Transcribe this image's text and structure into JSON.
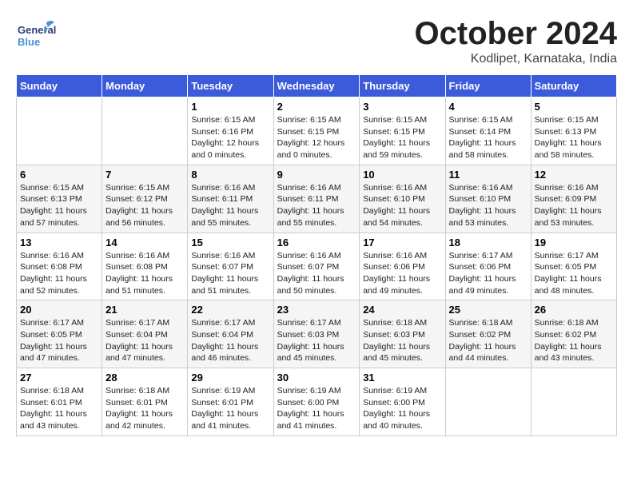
{
  "header": {
    "logo_general": "General",
    "logo_blue": "Blue",
    "month": "October 2024",
    "location": "Kodlipet, Karnataka, India"
  },
  "weekdays": [
    "Sunday",
    "Monday",
    "Tuesday",
    "Wednesday",
    "Thursday",
    "Friday",
    "Saturday"
  ],
  "weeks": [
    [
      {
        "day": "",
        "info": ""
      },
      {
        "day": "",
        "info": ""
      },
      {
        "day": "1",
        "info": "Sunrise: 6:15 AM\nSunset: 6:16 PM\nDaylight: 12 hours\nand 0 minutes."
      },
      {
        "day": "2",
        "info": "Sunrise: 6:15 AM\nSunset: 6:15 PM\nDaylight: 12 hours\nand 0 minutes."
      },
      {
        "day": "3",
        "info": "Sunrise: 6:15 AM\nSunset: 6:15 PM\nDaylight: 11 hours\nand 59 minutes."
      },
      {
        "day": "4",
        "info": "Sunrise: 6:15 AM\nSunset: 6:14 PM\nDaylight: 11 hours\nand 58 minutes."
      },
      {
        "day": "5",
        "info": "Sunrise: 6:15 AM\nSunset: 6:13 PM\nDaylight: 11 hours\nand 58 minutes."
      }
    ],
    [
      {
        "day": "6",
        "info": "Sunrise: 6:15 AM\nSunset: 6:13 PM\nDaylight: 11 hours\nand 57 minutes."
      },
      {
        "day": "7",
        "info": "Sunrise: 6:15 AM\nSunset: 6:12 PM\nDaylight: 11 hours\nand 56 minutes."
      },
      {
        "day": "8",
        "info": "Sunrise: 6:16 AM\nSunset: 6:11 PM\nDaylight: 11 hours\nand 55 minutes."
      },
      {
        "day": "9",
        "info": "Sunrise: 6:16 AM\nSunset: 6:11 PM\nDaylight: 11 hours\nand 55 minutes."
      },
      {
        "day": "10",
        "info": "Sunrise: 6:16 AM\nSunset: 6:10 PM\nDaylight: 11 hours\nand 54 minutes."
      },
      {
        "day": "11",
        "info": "Sunrise: 6:16 AM\nSunset: 6:10 PM\nDaylight: 11 hours\nand 53 minutes."
      },
      {
        "day": "12",
        "info": "Sunrise: 6:16 AM\nSunset: 6:09 PM\nDaylight: 11 hours\nand 53 minutes."
      }
    ],
    [
      {
        "day": "13",
        "info": "Sunrise: 6:16 AM\nSunset: 6:08 PM\nDaylight: 11 hours\nand 52 minutes."
      },
      {
        "day": "14",
        "info": "Sunrise: 6:16 AM\nSunset: 6:08 PM\nDaylight: 11 hours\nand 51 minutes."
      },
      {
        "day": "15",
        "info": "Sunrise: 6:16 AM\nSunset: 6:07 PM\nDaylight: 11 hours\nand 51 minutes."
      },
      {
        "day": "16",
        "info": "Sunrise: 6:16 AM\nSunset: 6:07 PM\nDaylight: 11 hours\nand 50 minutes."
      },
      {
        "day": "17",
        "info": "Sunrise: 6:16 AM\nSunset: 6:06 PM\nDaylight: 11 hours\nand 49 minutes."
      },
      {
        "day": "18",
        "info": "Sunrise: 6:17 AM\nSunset: 6:06 PM\nDaylight: 11 hours\nand 49 minutes."
      },
      {
        "day": "19",
        "info": "Sunrise: 6:17 AM\nSunset: 6:05 PM\nDaylight: 11 hours\nand 48 minutes."
      }
    ],
    [
      {
        "day": "20",
        "info": "Sunrise: 6:17 AM\nSunset: 6:05 PM\nDaylight: 11 hours\nand 47 minutes."
      },
      {
        "day": "21",
        "info": "Sunrise: 6:17 AM\nSunset: 6:04 PM\nDaylight: 11 hours\nand 47 minutes."
      },
      {
        "day": "22",
        "info": "Sunrise: 6:17 AM\nSunset: 6:04 PM\nDaylight: 11 hours\nand 46 minutes."
      },
      {
        "day": "23",
        "info": "Sunrise: 6:17 AM\nSunset: 6:03 PM\nDaylight: 11 hours\nand 45 minutes."
      },
      {
        "day": "24",
        "info": "Sunrise: 6:18 AM\nSunset: 6:03 PM\nDaylight: 11 hours\nand 45 minutes."
      },
      {
        "day": "25",
        "info": "Sunrise: 6:18 AM\nSunset: 6:02 PM\nDaylight: 11 hours\nand 44 minutes."
      },
      {
        "day": "26",
        "info": "Sunrise: 6:18 AM\nSunset: 6:02 PM\nDaylight: 11 hours\nand 43 minutes."
      }
    ],
    [
      {
        "day": "27",
        "info": "Sunrise: 6:18 AM\nSunset: 6:01 PM\nDaylight: 11 hours\nand 43 minutes."
      },
      {
        "day": "28",
        "info": "Sunrise: 6:18 AM\nSunset: 6:01 PM\nDaylight: 11 hours\nand 42 minutes."
      },
      {
        "day": "29",
        "info": "Sunrise: 6:19 AM\nSunset: 6:01 PM\nDaylight: 11 hours\nand 41 minutes."
      },
      {
        "day": "30",
        "info": "Sunrise: 6:19 AM\nSunset: 6:00 PM\nDaylight: 11 hours\nand 41 minutes."
      },
      {
        "day": "31",
        "info": "Sunrise: 6:19 AM\nSunset: 6:00 PM\nDaylight: 11 hours\nand 40 minutes."
      },
      {
        "day": "",
        "info": ""
      },
      {
        "day": "",
        "info": ""
      }
    ]
  ]
}
